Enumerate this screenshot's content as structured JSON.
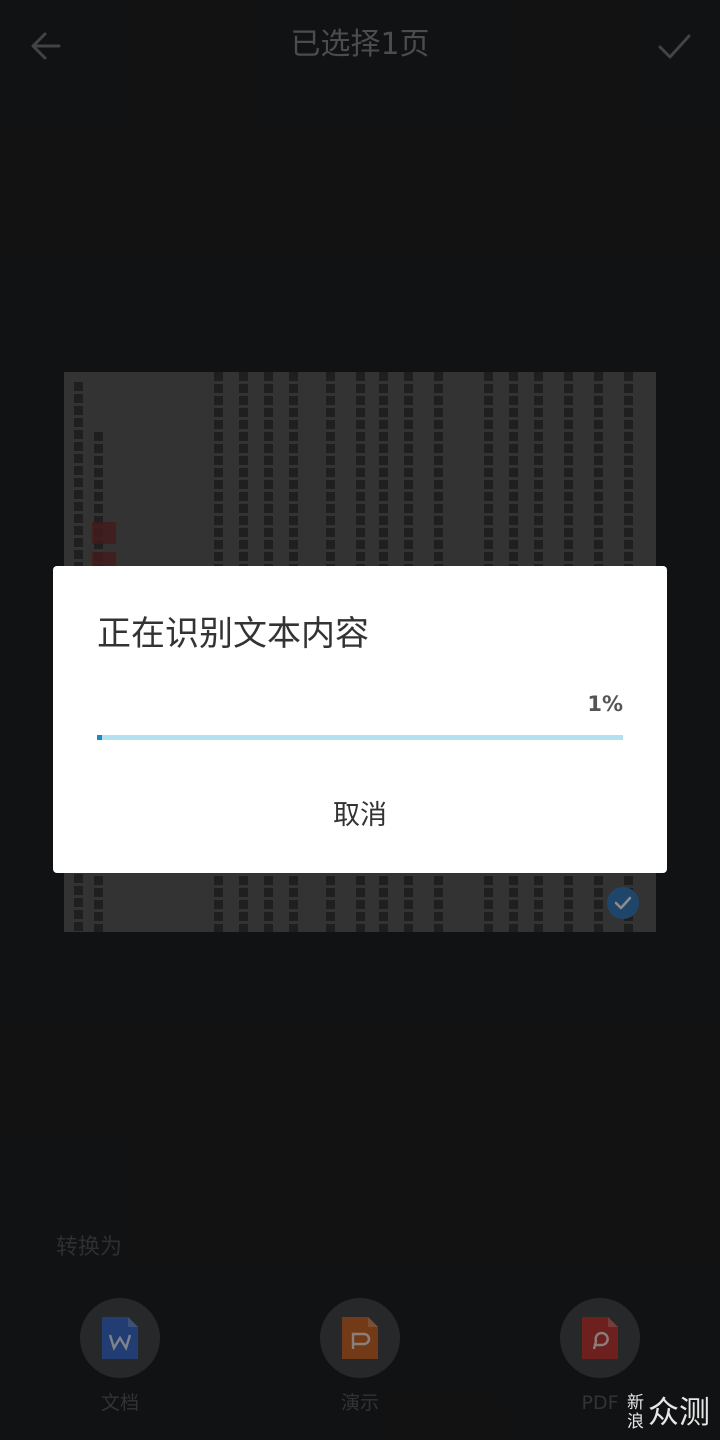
{
  "header": {
    "title": "已选择1页"
  },
  "bottom": {
    "convert_label": "转换为",
    "options": [
      {
        "label": "文档",
        "icon": "word-doc-icon",
        "color": "#3d6fd1"
      },
      {
        "label": "演示",
        "icon": "ppt-icon",
        "color": "#d26a2c"
      },
      {
        "label": "PDF",
        "icon": "pdf-icon",
        "color": "#c93b37"
      }
    ]
  },
  "dialog": {
    "title": "正在识别文本内容",
    "progress_text": "1%",
    "progress_value": 0.01,
    "cancel_label": "取消"
  },
  "watermark": {
    "small_top": "新",
    "small_bottom": "浪",
    "big": "众测"
  },
  "colors": {
    "background": "#202123",
    "progress_track": "#b3e0ef",
    "progress_fill": "#1a8ac4",
    "check": "#3b7fc4"
  }
}
